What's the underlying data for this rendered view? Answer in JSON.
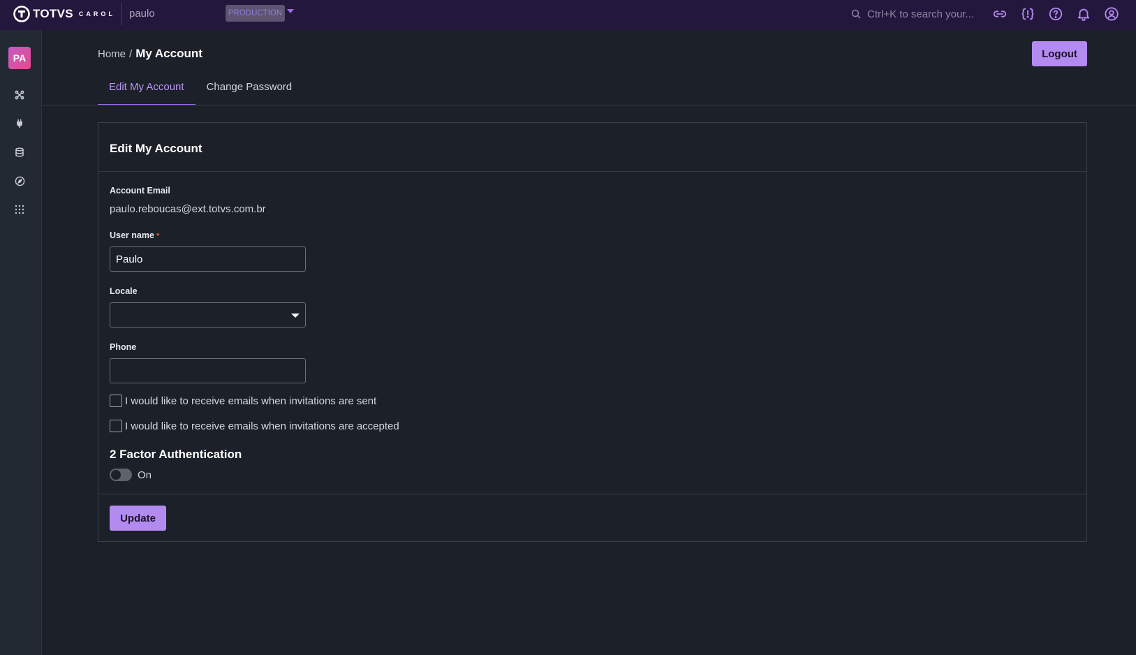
{
  "topbar": {
    "brand_name": "TOTVS",
    "brand_product": "CAROL",
    "tenant": "paulo",
    "environment": "PRODUCTION",
    "search_placeholder": "Ctrl+K to search your...",
    "icons": [
      "link-icon",
      "code-braces-icon",
      "help-icon",
      "bell-icon",
      "user-circle-icon"
    ],
    "accent_color": "#b38af0"
  },
  "sidebar": {
    "avatar_initials": "PA",
    "items": [
      "share-nodes-icon",
      "plug-icon",
      "database-icon",
      "compass-icon",
      "apps-grid-icon"
    ]
  },
  "header": {
    "breadcrumb_home": "Home",
    "breadcrumb_separator": "/",
    "breadcrumb_current": "My Account",
    "logout_label": "Logout"
  },
  "tabs": [
    {
      "label": "Edit My Account",
      "active": true
    },
    {
      "label": "Change Password",
      "active": false
    }
  ],
  "form": {
    "title": "Edit My Account",
    "account_email_label": "Account Email",
    "account_email_value": "paulo.reboucas@ext.totvs.com.br",
    "username_label": "User name",
    "username_required_mark": "*",
    "username_value": "Paulo",
    "locale_label": "Locale",
    "locale_value": "",
    "phone_label": "Phone",
    "phone_value": "",
    "checkbox_sent_label": "I would like to receive emails when invitations are sent",
    "checkbox_sent_checked": false,
    "checkbox_accepted_label": "I would like to receive emails when invitations are accepted",
    "checkbox_accepted_checked": false,
    "twofa_title": "2 Factor Authentication",
    "twofa_toggle_label": "On",
    "twofa_enabled": false,
    "update_label": "Update"
  }
}
